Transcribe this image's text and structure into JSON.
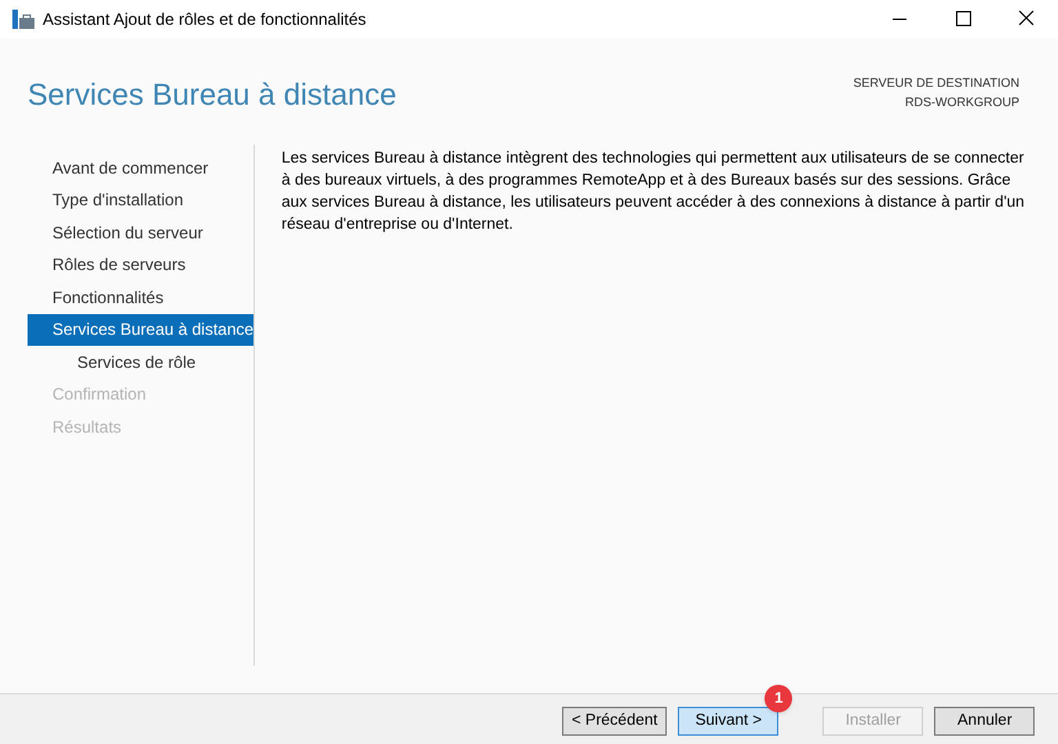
{
  "window": {
    "title": "Assistant Ajout de rôles et de fonctionnalités"
  },
  "page_title": "Services Bureau à distance",
  "destination": {
    "label": "SERVEUR DE DESTINATION",
    "server": "RDS-WORKGROUP"
  },
  "nav": [
    {
      "label": "Avant de commencer",
      "selected": false,
      "disabled": false
    },
    {
      "label": "Type d'installation",
      "selected": false,
      "disabled": false
    },
    {
      "label": "Sélection du serveur",
      "selected": false,
      "disabled": false
    },
    {
      "label": "Rôles de serveurs",
      "selected": false,
      "disabled": false
    },
    {
      "label": "Fonctionnalités",
      "selected": false,
      "disabled": false
    },
    {
      "label": "Services Bureau à distance",
      "selected": true,
      "disabled": false,
      "children": [
        {
          "label": "Services de rôle",
          "selected": false,
          "disabled": false
        }
      ]
    },
    {
      "label": "Confirmation",
      "selected": false,
      "disabled": true
    },
    {
      "label": "Résultats",
      "selected": false,
      "disabled": true
    }
  ],
  "description": "Les services Bureau à distance intègrent des technologies qui permettent aux utilisateurs de se connecter à des bureaux virtuels, à des programmes RemoteApp et à des Bureaux basés sur des sessions. Grâce aux services Bureau à distance, les utilisateurs peuvent accéder à des connexions à distance à partir d'un réseau d'entreprise ou d'Internet.",
  "buttons": [
    {
      "label": "< Précédent",
      "focused": false,
      "disabled": false
    },
    {
      "label": "Suivant >",
      "focused": true,
      "disabled": false,
      "badge": "1"
    },
    {
      "label": "Installer",
      "focused": false,
      "disabled": true
    },
    {
      "label": "Annuler",
      "focused": false,
      "disabled": false
    }
  ]
}
